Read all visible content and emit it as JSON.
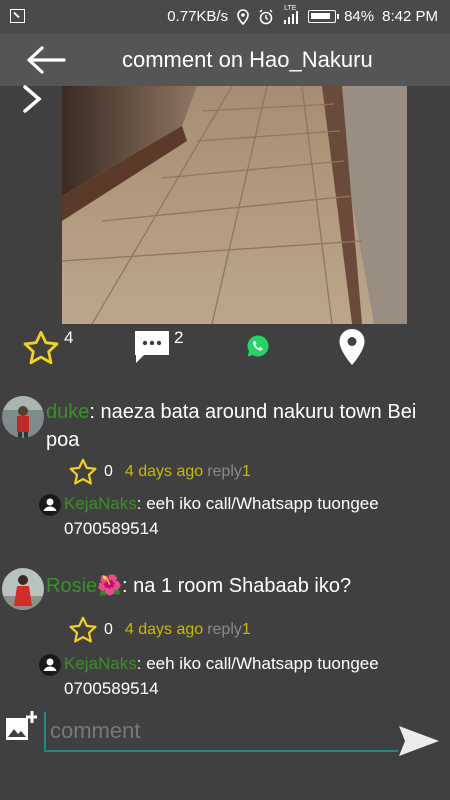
{
  "status_bar": {
    "speed": "0.77KB/s",
    "network": "LTE",
    "battery": "84%",
    "time": "8:42 PM"
  },
  "app_bar": {
    "title": "comment on Hao_Nakuru"
  },
  "post": {
    "likes": "4",
    "comments": "2"
  },
  "comments": [
    {
      "user": "duke",
      "text": ": naeza bata around nakuru town Bei poa",
      "likes": "0",
      "time": "4 days ago",
      "reply_label": "reply",
      "reply_count": "1",
      "reply": {
        "user": "KejaNaks",
        "text": ": eeh iko call/Whatsapp tuongee",
        "phone": "0700589514"
      }
    },
    {
      "user": "Rosie",
      "emoji": "🌺",
      "text": ": na 1 room Shabaab iko?",
      "likes": "0",
      "time": "4 days ago",
      "reply_label": "reply",
      "reply_count": "1",
      "reply": {
        "user": "KejaNaks",
        "text": ": eeh iko call/Whatsapp tuongee",
        "phone": "0700589514"
      }
    }
  ],
  "composer": {
    "placeholder": "comment"
  },
  "colors": {
    "background": "#404040",
    "app_bar": "#555555",
    "username": "#3a8f2a",
    "timestamp": "#c8b900",
    "star": "#f2d21b",
    "input_underline": "#1a8b86"
  },
  "icons": [
    "back-arrow-icon",
    "chevron-right-icon",
    "star-icon",
    "chat-icon",
    "whatsapp-icon",
    "location-pin-icon",
    "user-icon",
    "add-photo-icon",
    "send-icon"
  ]
}
